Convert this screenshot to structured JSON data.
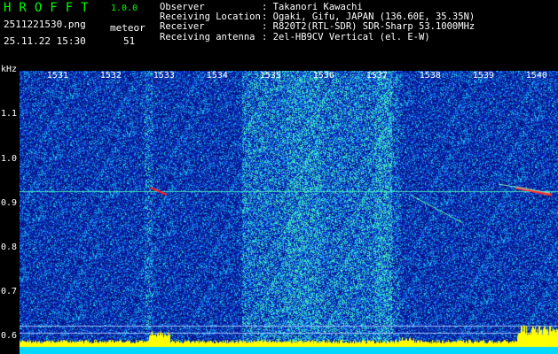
{
  "app": {
    "title": "HROFFT",
    "version": "1.0.0"
  },
  "file_name": "2511221530.png",
  "date_time": "25.11.22 15:30",
  "meteor": {
    "label": "meteor",
    "count": "51"
  },
  "info": [
    {
      "label": "Observer",
      "value": ": Takanori Kawachi"
    },
    {
      "label": "Receiving Location",
      "value": ": Ogaki, Gifu, JAPAN (136.60E, 35.35N)"
    },
    {
      "label": "Receiver",
      "value": ": R820T2(RTL-SDR) SDR-Sharp 53.1000MHz"
    },
    {
      "label": "Receiving antenna",
      "value": ": 2el-HB9CV Vertical (el. E-W)"
    }
  ],
  "axis": {
    "y_unit": "kHz",
    "x_ticks": [
      "1531",
      "1532",
      "1533",
      "1534",
      "1535",
      "1536",
      "1537",
      "1538",
      "1539",
      "1540"
    ],
    "y_ticks": [
      "1.1",
      "1.0",
      "0.9",
      "0.8",
      "0.7",
      "0.6"
    ]
  },
  "colors": {
    "background": "#000000",
    "waterfall_base": "#0b1f8a",
    "title_green": "#00ff00",
    "trace_yellow": "#ffff00",
    "trace_cyan": "#00d8ff",
    "meteor_red": "#ff2020"
  }
}
